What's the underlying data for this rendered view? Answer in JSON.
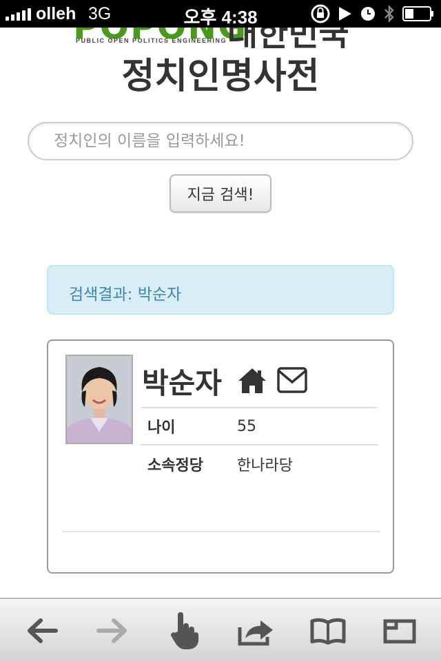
{
  "status_bar": {
    "carrier": "olleh",
    "network": "3G",
    "time": "오후 4:38",
    "icons": [
      "signal-bars-icon",
      "orientation-lock-icon",
      "play-icon",
      "alarm-icon",
      "bluetooth-icon",
      "battery-icon"
    ]
  },
  "header": {
    "logo_text": "POPONG",
    "logo_subtitle": "PUBLIC OPEN POLITICS ENGINEERING",
    "logo_suffix": "대한민국",
    "title": "정치인명사전"
  },
  "search": {
    "placeholder": "정치인의 이름을 입력하세요!",
    "value": "",
    "button_label": "지금 검색!"
  },
  "result": {
    "text": "검색결과: 박순자"
  },
  "politician": {
    "name": "박순자",
    "icons": [
      "home-icon",
      "mail-icon"
    ],
    "rows": [
      {
        "label": "나이",
        "value": "55"
      },
      {
        "label": "소속정당",
        "value": "한나라당"
      }
    ]
  },
  "toolbar": {
    "buttons": [
      "back-arrow-icon",
      "forward-arrow-icon",
      "pointer-hand-icon",
      "share-icon",
      "bookmarks-icon",
      "tabs-icon"
    ]
  },
  "colors": {
    "logo_green": "#4a9a1a",
    "alert_bg": "#d9edf7",
    "alert_text": "#3a87ad",
    "text": "#333333"
  }
}
